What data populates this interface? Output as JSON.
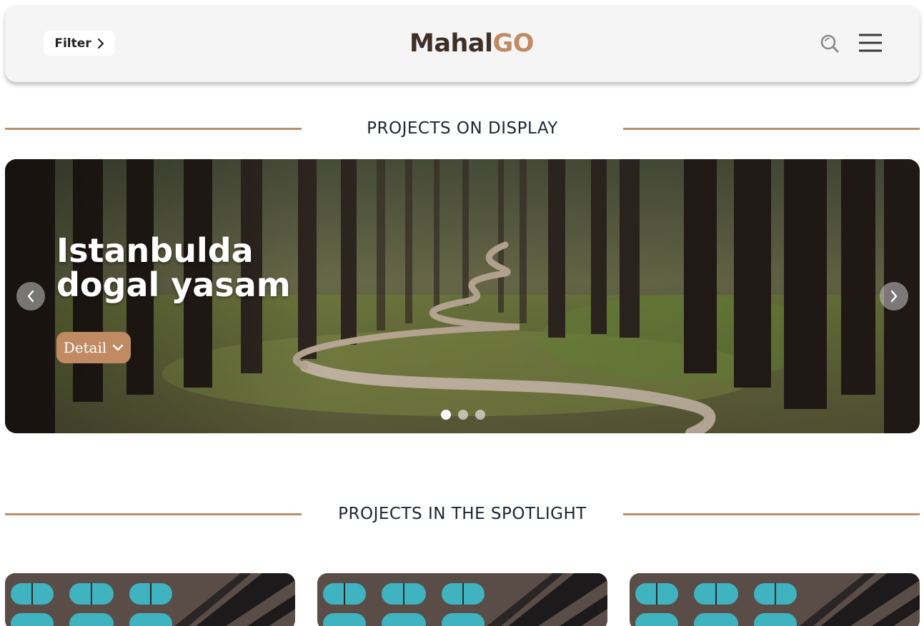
{
  "header": {
    "filter_label": "Filter",
    "logo_text": "Mahal",
    "logo_accent": "GO",
    "search_icon": "search-icon",
    "menu_icon": "hamburger-menu-icon"
  },
  "sections": {
    "display_title": "PROJECTS ON DISPLAY",
    "spotlight_title": "PROJECTS IN THE SPOTLIGHT"
  },
  "hero": {
    "title_line1": "Istanbulda",
    "title_line2": "dogal yasam",
    "detail_label": "Detail",
    "slides_count": 3,
    "active_slide": 1
  },
  "colors": {
    "accent": "#c08a63",
    "divider": "#b8906e",
    "header_bg": "#f5f5f5",
    "logo_dark": "#3d2f26"
  }
}
